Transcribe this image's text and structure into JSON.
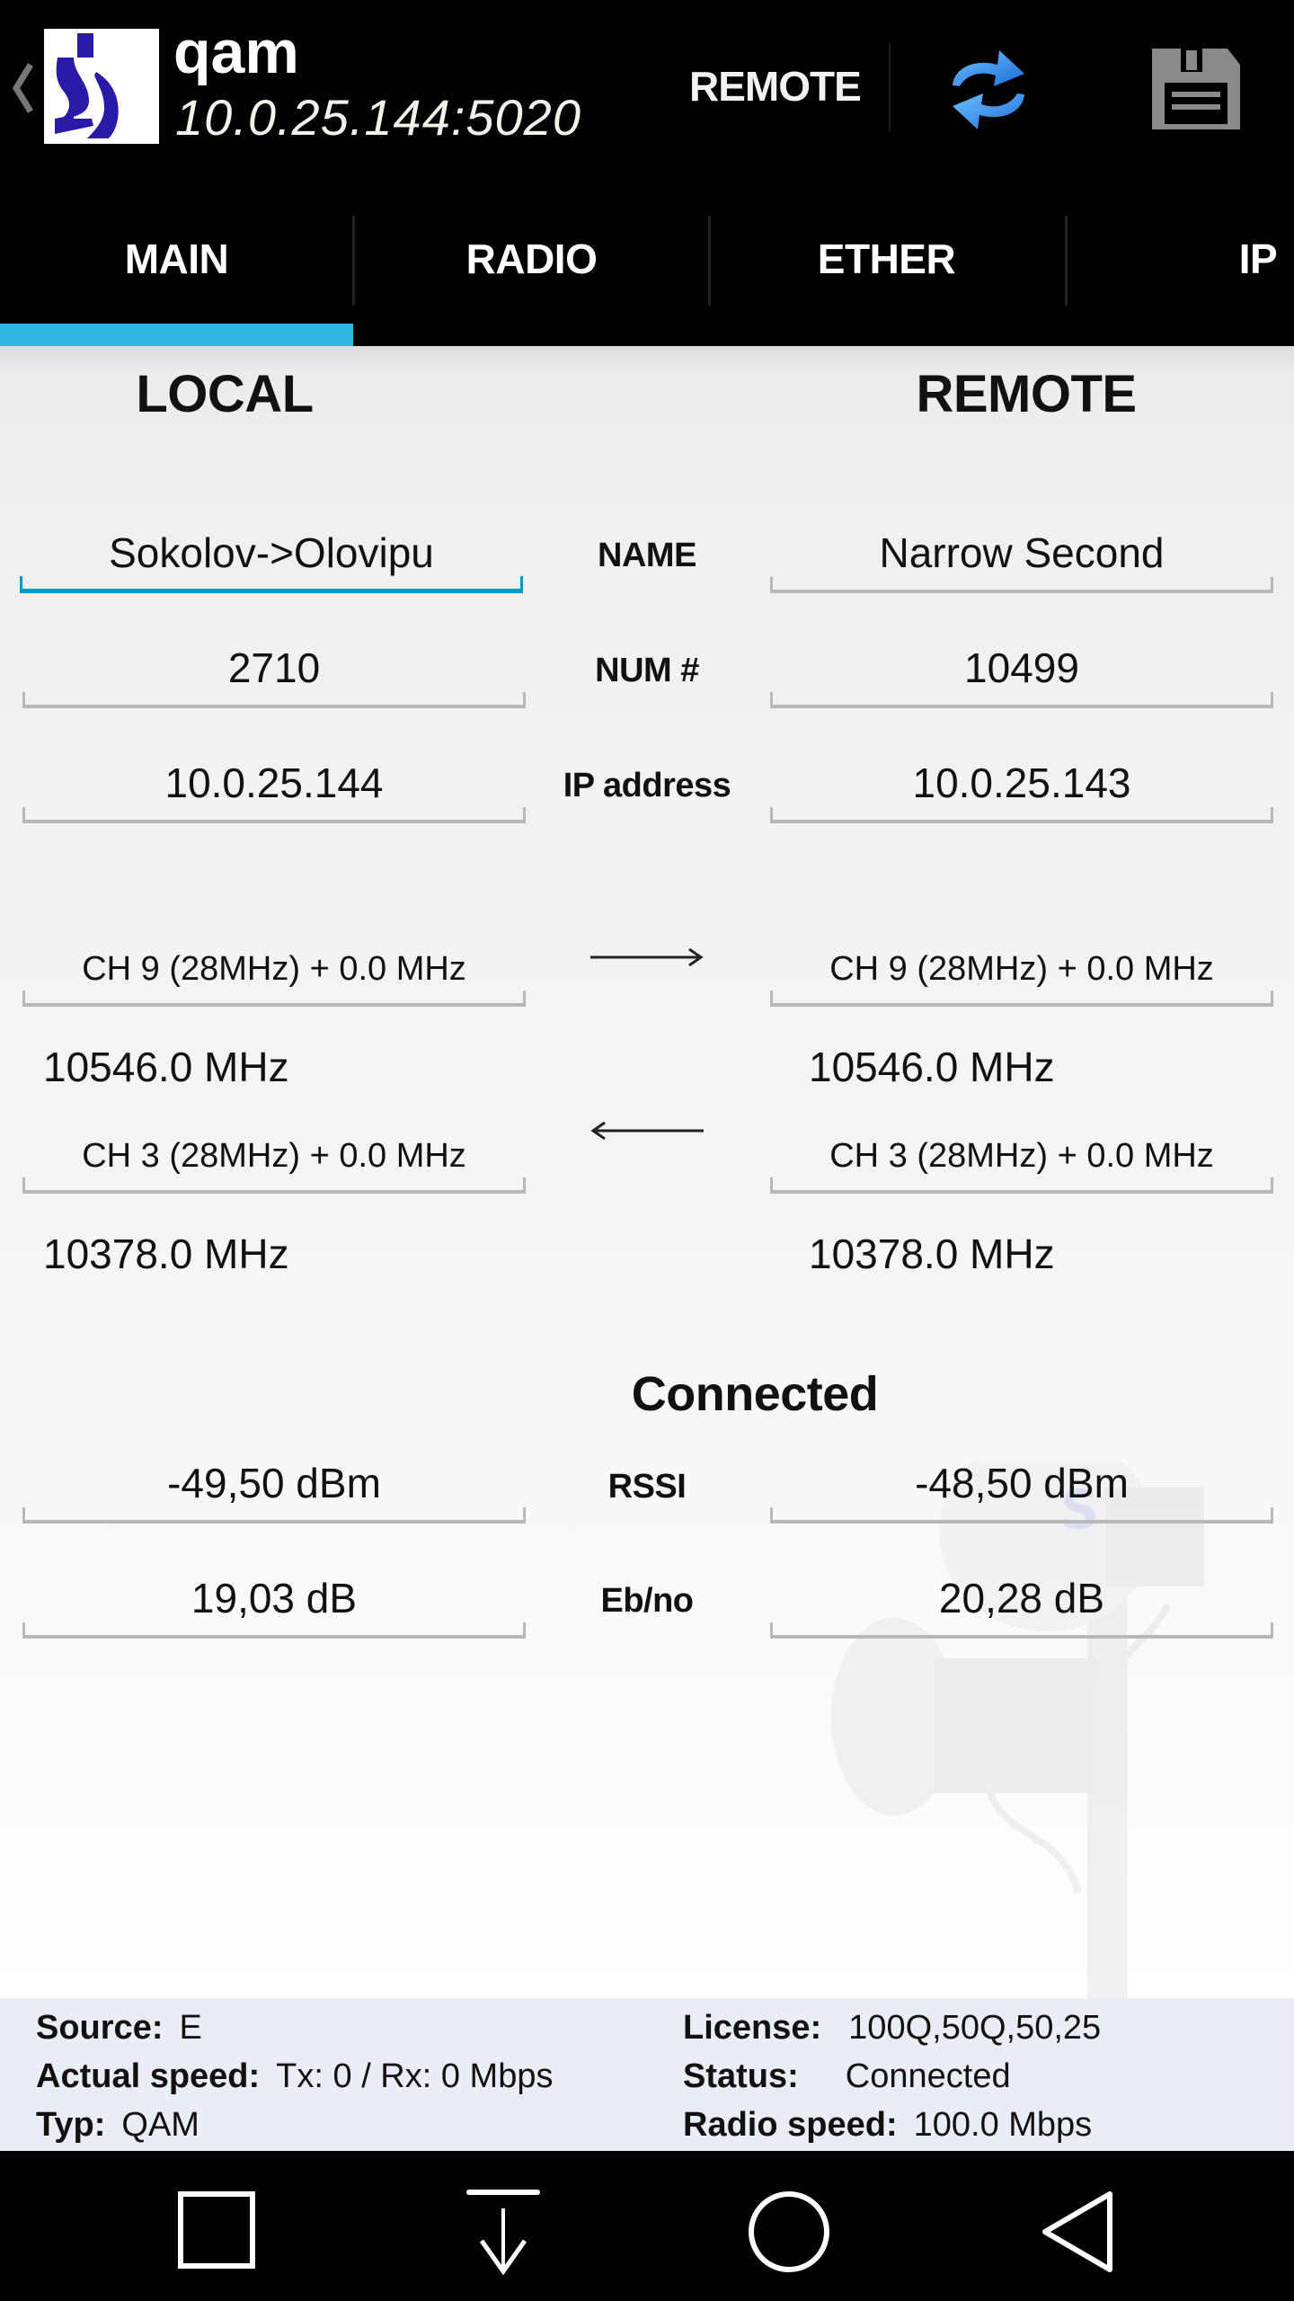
{
  "actionbar": {
    "title": "qam",
    "subtitle": "10.0.25.144:5020",
    "remote_label": "REMOTE",
    "icons": {
      "up": "chevron-left-icon",
      "logo": "app-logo",
      "refresh": "refresh-icon",
      "save": "floppy-save-icon"
    },
    "logo_color": "#2a1aa8",
    "refresh_color": "#2d8fe6"
  },
  "tabs": [
    {
      "label": "MAIN",
      "selected": true
    },
    {
      "label": "RADIO",
      "selected": false
    },
    {
      "label": "ETHER",
      "selected": false
    },
    {
      "label": "IP",
      "selected": false
    }
  ],
  "tab_indicator_color": "#33b5e5",
  "main": {
    "local_header": "LOCAL",
    "remote_header": "REMOTE",
    "rows": [
      {
        "label": "NAME",
        "local": "Sokolov->Olovipu",
        "remote": "Narrow Second"
      },
      {
        "label": "NUM #",
        "local": "2710",
        "remote": "10499"
      },
      {
        "label": "IP address",
        "local": "10.0.25.144",
        "remote": "10.0.25.143"
      }
    ],
    "channels": [
      {
        "direction": "right-arrow-icon",
        "local": "CH 9 (28MHz) + 0.0 MHz",
        "remote": "CH 9 (28MHz) + 0.0 MHz",
        "local_freq": "10546.0 MHz",
        "remote_freq": "10546.0 MHz"
      },
      {
        "direction": "left-arrow-icon",
        "local": "CH 3 (28MHz) + 0.0 MHz",
        "remote": "CH 3 (28MHz) + 0.0 MHz",
        "local_freq": "10378.0 MHz",
        "remote_freq": "10378.0 MHz"
      }
    ],
    "link_status": "Connected",
    "metrics": [
      {
        "label": "RSSI",
        "local": "-49,50 dBm",
        "remote": "-48,50 dBm"
      },
      {
        "label": "Eb/no",
        "local": "19,03 dB",
        "remote": "20,28 dB"
      }
    ]
  },
  "info": {
    "left": [
      {
        "label": "Source:",
        "value": "E"
      },
      {
        "label": "Actual speed:",
        "value": "Tx: 0 / Rx: 0 Mbps"
      },
      {
        "label": "Typ:",
        "value": "QAM"
      }
    ],
    "right": [
      {
        "label": "License:",
        "value": "100Q,50Q,50,25"
      },
      {
        "label": "Status:",
        "value": "Connected"
      },
      {
        "label": "Radio speed:",
        "value": "100.0 Mbps"
      }
    ]
  },
  "navbar": {
    "icons": [
      "recents-icon",
      "download-icon",
      "home-icon",
      "back-icon"
    ]
  }
}
